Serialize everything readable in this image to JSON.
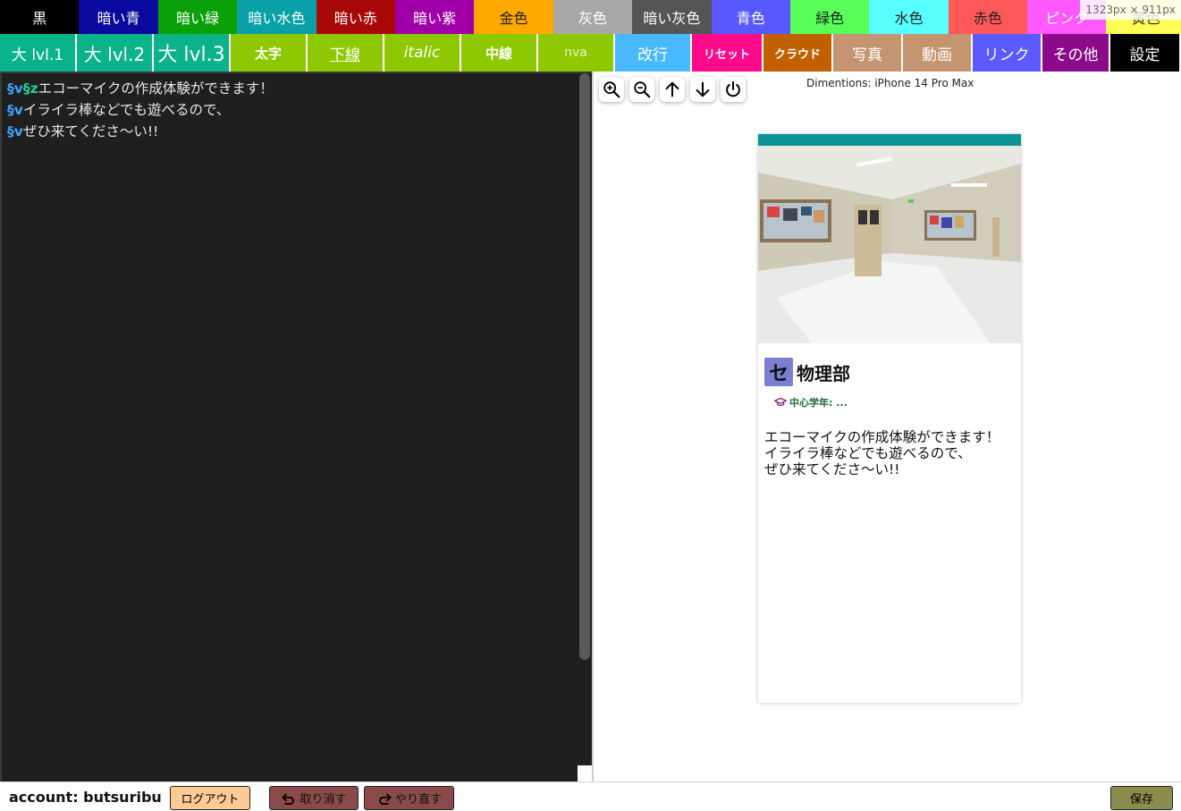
{
  "colors_row": [
    {
      "label": "黒",
      "bg": "#000000",
      "fg": "#ffffff"
    },
    {
      "label": "暗い青",
      "bg": "#0a0aa0",
      "fg": "#ffffff"
    },
    {
      "label": "暗い緑",
      "bg": "#0aa00a",
      "fg": "#ffffff"
    },
    {
      "label": "暗い水色",
      "bg": "#0aa0a8",
      "fg": "#ffffff"
    },
    {
      "label": "暗い赤",
      "bg": "#a80808",
      "fg": "#ffffff"
    },
    {
      "label": "暗い紫",
      "bg": "#a000a8",
      "fg": "#ffffff"
    },
    {
      "label": "金色",
      "bg": "#ffa800",
      "fg": "#222222"
    },
    {
      "label": "灰色",
      "bg": "#a8a8a8",
      "fg": "#ffffff"
    },
    {
      "label": "暗い灰色",
      "bg": "#555555",
      "fg": "#ffffff"
    },
    {
      "label": "青色",
      "bg": "#5858ff",
      "fg": "#ffffff"
    },
    {
      "label": "緑色",
      "bg": "#58ff58",
      "fg": "#222222"
    },
    {
      "label": "水色",
      "bg": "#58ffff",
      "fg": "#222222"
    },
    {
      "label": "赤色",
      "bg": "#ff5858",
      "fg": "#222222"
    },
    {
      "label": "ピンク",
      "bg": "#ff58ff",
      "fg": "#ffffff"
    },
    {
      "label": "黄色",
      "bg": "#ffff58",
      "fg": "#222222"
    }
  ],
  "format_row": [
    {
      "label": "大 lvl.1",
      "bg": "#0ab38a",
      "fg": "#ffffff",
      "w": 86,
      "style": "normal"
    },
    {
      "label": "大 lvl.2",
      "bg": "#0ab38a",
      "fg": "#ffffff",
      "w": 86,
      "style": "big2"
    },
    {
      "label": "大 lvl.3",
      "bg": "#0ab38a",
      "fg": "#ffffff",
      "w": 86,
      "style": "big3"
    },
    {
      "label": "太字",
      "bg": "#8ec800",
      "fg": "#ffffff",
      "w": 86,
      "style": "bold"
    },
    {
      "label": "下線",
      "bg": "#8ec800",
      "fg": "#ffffff",
      "w": 86,
      "style": "underline"
    },
    {
      "label": "italic",
      "bg": "#8ec800",
      "fg": "#ffffff",
      "w": 86,
      "style": "italic"
    },
    {
      "label": "中線",
      "bg": "#8ec800",
      "fg": "#ffffff",
      "w": 86,
      "style": "bold"
    },
    {
      "label": "nva",
      "bg": "#8ec800",
      "fg": "#e8f5c8",
      "w": 86,
      "style": "small"
    },
    {
      "label": "改行",
      "bg": "#48b8ff",
      "fg": "#ffffff",
      "w": 86,
      "style": "normal"
    },
    {
      "label": "リセット",
      "bg": "#ff0a8a",
      "fg": "#ffffff",
      "w": 80,
      "style": "boldsmall"
    },
    {
      "label": "クラウド",
      "bg": "#c06000",
      "fg": "#ffffff",
      "w": 78,
      "style": "boldsmall"
    },
    {
      "label": "写真",
      "bg": "#c49570",
      "fg": "#ffffff",
      "w": 78,
      "style": "normal"
    },
    {
      "label": "動画",
      "bg": "#c49570",
      "fg": "#ffffff",
      "w": 78,
      "style": "normal"
    },
    {
      "label": "リンク",
      "bg": "#5a5aff",
      "fg": "#ffffff",
      "w": 78,
      "style": "normal"
    },
    {
      "label": "その他",
      "bg": "#8a0a8a",
      "fg": "#ffffff",
      "w": 76,
      "style": "normal"
    },
    {
      "label": "設定",
      "bg": "#000000",
      "fg": "#ffffff",
      "w": 77,
      "style": "normal"
    }
  ],
  "size_hint": "1323px × 911px",
  "editor": {
    "lines": [
      {
        "tokens": [
          "§v",
          "§z"
        ],
        "text": "エコーマイクの作成体験ができます！"
      },
      {
        "tokens": [
          "§v"
        ],
        "text": "イライラ棒などでも遊べるので、"
      },
      {
        "tokens": [
          "§v"
        ],
        "text": "ぜひ来てくださ〜い!!"
      }
    ]
  },
  "preview": {
    "dimensions": "Dimentions: iPhone 14 Pro Max",
    "tools": [
      "zoom-in-icon",
      "zoom-out-icon",
      "arrow-up-icon",
      "arrow-down-icon",
      "power-icon"
    ],
    "club_logo": "セ",
    "club_name": "物理部",
    "grade": "中心学年: ...",
    "accent": "#0b9294",
    "text_lines": [
      "エコーマイクの作成体験ができます！",
      "イライラ棒などでも遊べるので、",
      "ぜひ来てくださ〜い!!"
    ]
  },
  "footer": {
    "account": "account: butsuribu",
    "logout": "ログアウト",
    "undo": "取り消す",
    "redo": "やり直す",
    "save": "保存"
  }
}
